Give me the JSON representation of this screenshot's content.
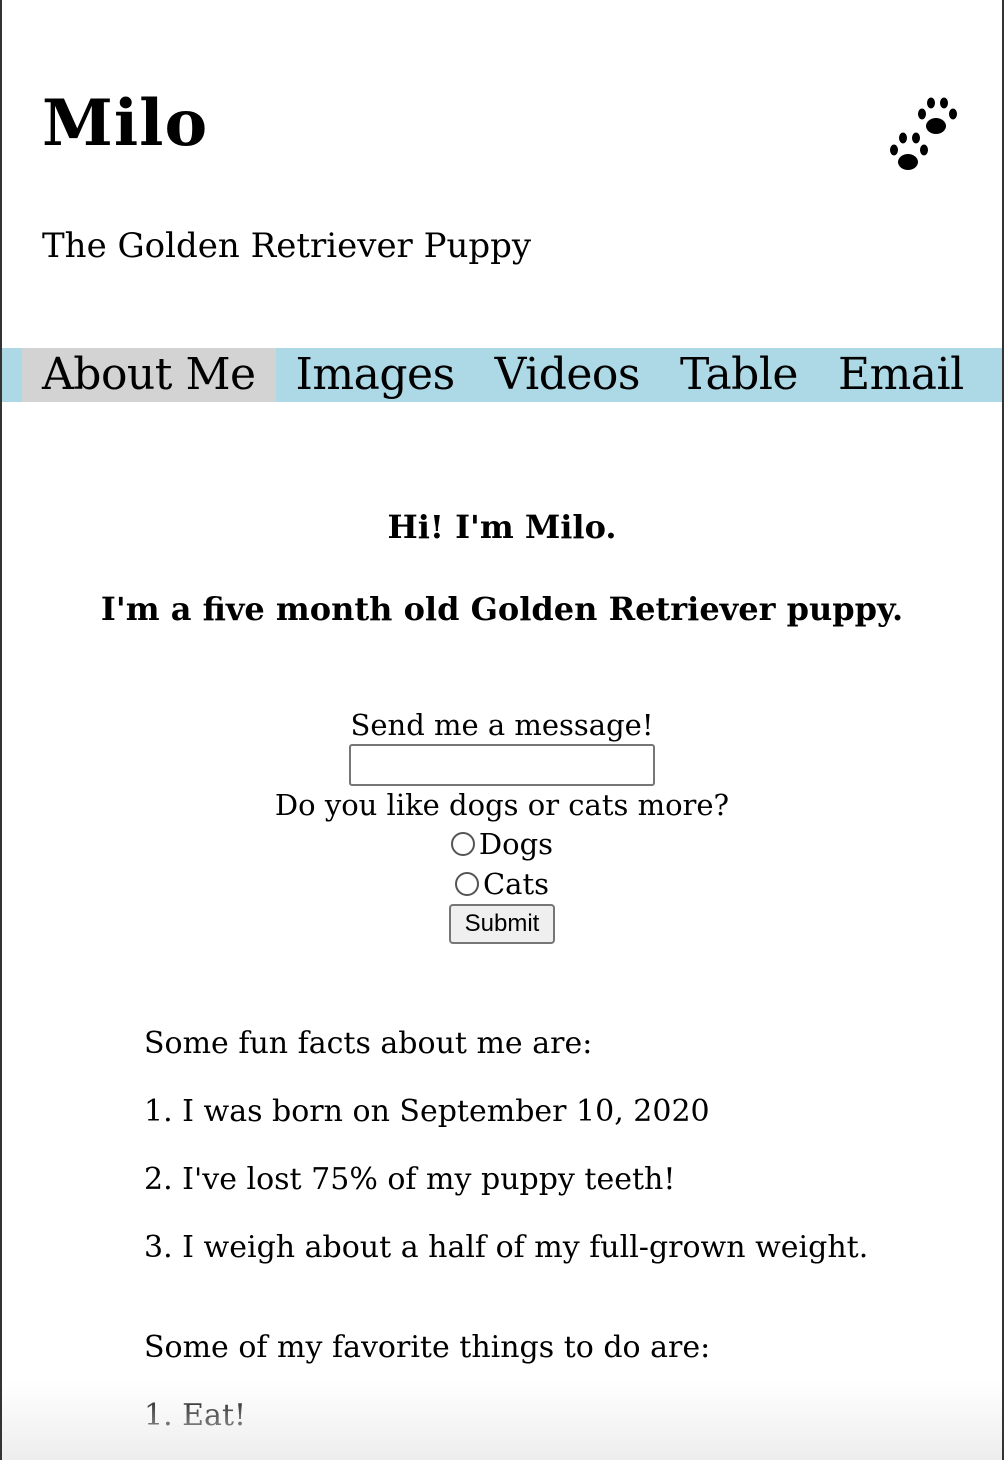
{
  "header": {
    "title": "Milo",
    "subtitle": "The Golden Retriever Puppy",
    "icon": "paw-prints-icon"
  },
  "nav": {
    "items": [
      {
        "label": "About Me",
        "active": true
      },
      {
        "label": "Images",
        "active": false
      },
      {
        "label": "Videos",
        "active": false
      },
      {
        "label": "Table",
        "active": false
      },
      {
        "label": "Email",
        "active": false
      }
    ],
    "background": "#add8e6",
    "active_background": "#d3d3d3"
  },
  "main": {
    "greeting": "Hi! I'm Milo.",
    "intro": "I'm a five month old Golden Retriever puppy."
  },
  "form": {
    "message_label": "Send me a message!",
    "message_value": "",
    "question": "Do you like dogs or cats more?",
    "options": [
      "Dogs",
      "Cats"
    ],
    "submit_label": "Submit"
  },
  "facts": {
    "heading": "Some fun facts about me are:",
    "items": [
      "1. I was born on September 10, 2020",
      "2. I've lost 75% of my puppy teeth!",
      "3. I weigh about a half of my full-grown weight."
    ]
  },
  "favorites": {
    "heading": "Some of my favorite things to do are:",
    "items": [
      "1. Eat!"
    ]
  }
}
